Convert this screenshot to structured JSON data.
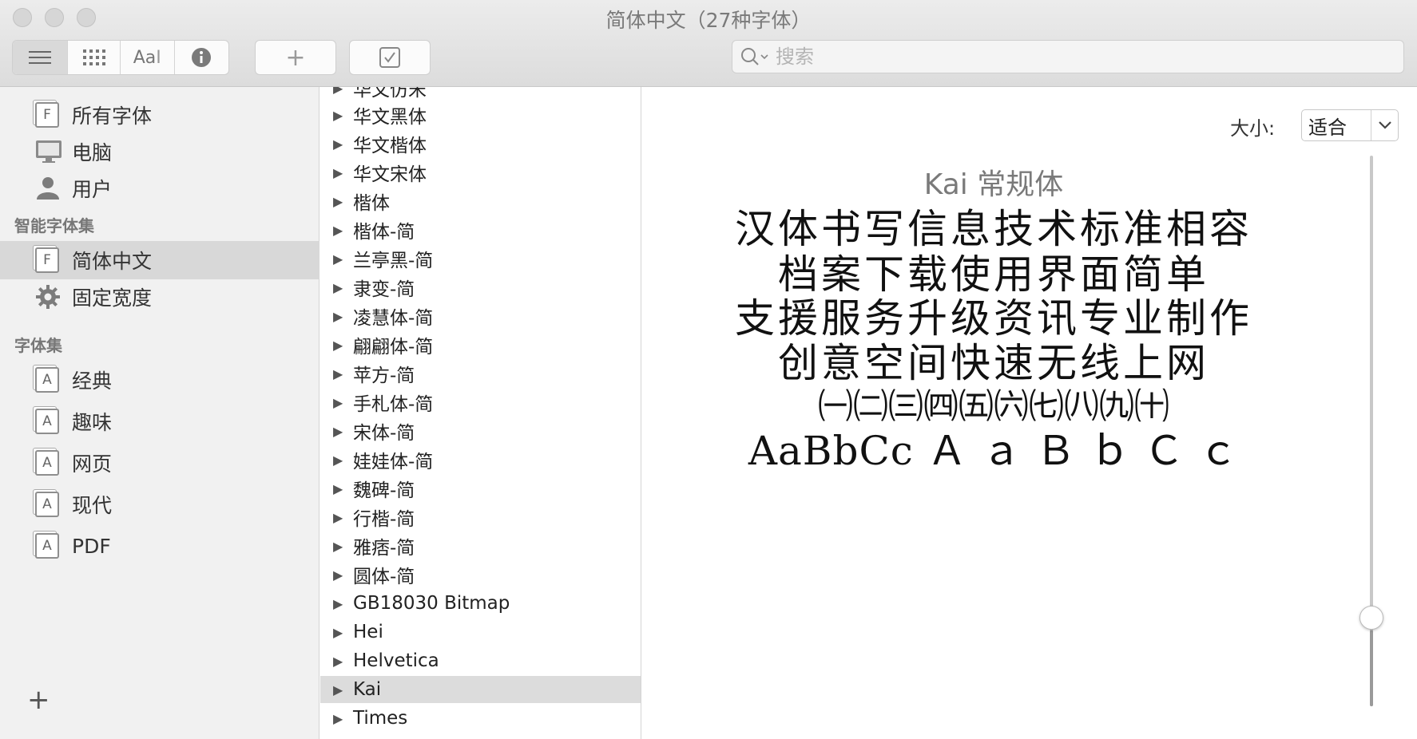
{
  "window": {
    "title": "简体中文（27种字体）"
  },
  "toolbar": {
    "view_text_glyph": "Aa",
    "add_symbol": "+",
    "check_symbol": "✓"
  },
  "search": {
    "placeholder": "搜索",
    "value": ""
  },
  "sidebar": {
    "top_items": [
      {
        "label": "所有字体",
        "icon": "font-book-icon"
      },
      {
        "label": "电脑",
        "icon": "computer-icon"
      },
      {
        "label": "用户",
        "icon": "user-icon"
      }
    ],
    "smart_section_title": "智能字体集",
    "smart_items": [
      {
        "label": "简体中文",
        "icon": "font-book-icon",
        "selected": true
      },
      {
        "label": "固定宽度",
        "icon": "gear-icon"
      }
    ],
    "collections_section_title": "字体集",
    "collection_items": [
      {
        "label": "经典",
        "icon": "collection-icon"
      },
      {
        "label": "趣味",
        "icon": "collection-icon"
      },
      {
        "label": "网页",
        "icon": "collection-icon"
      },
      {
        "label": "现代",
        "icon": "collection-icon"
      },
      {
        "label": "PDF",
        "icon": "collection-icon"
      }
    ],
    "add_symbol": "+",
    "book_glyph": "F",
    "collection_glyph": "A"
  },
  "font_list": {
    "items": [
      "华文仿宋",
      "华文黑体",
      "华文楷体",
      "华文宋体",
      "楷体",
      "楷体-简",
      "兰亭黑-简",
      "隶变-简",
      "凌慧体-简",
      "翩翩体-简",
      "苹方-简",
      "手札体-简",
      "宋体-简",
      "娃娃体-简",
      "魏碑-简",
      "行楷-简",
      "雅痞-简",
      "圆体-简",
      "GB18030 Bitmap",
      "Hei",
      "Helvetica",
      "Kai",
      "Times"
    ],
    "selected": "Kai"
  },
  "preview": {
    "size_label": "大小:",
    "size_value": "适合",
    "font_name": "Kai 常规体",
    "sample_lines": [
      "汉体书写信息技术标准相容",
      "档案下载使用界面简单",
      "支援服务升级资讯专业制作",
      "创意空间快速无线上网",
      "㈠㈡㈢㈣㈤㈥㈦㈧㈨㈩",
      "AaBbCc Ａ ａ Ｂ ｂ Ｃ ｃ"
    ],
    "slider_fraction": 0.15
  },
  "colors": {
    "selection": "#d8d8d8",
    "sidebar_bg": "#f1f1f1",
    "titlebar_bg": "#e4e4e4"
  }
}
